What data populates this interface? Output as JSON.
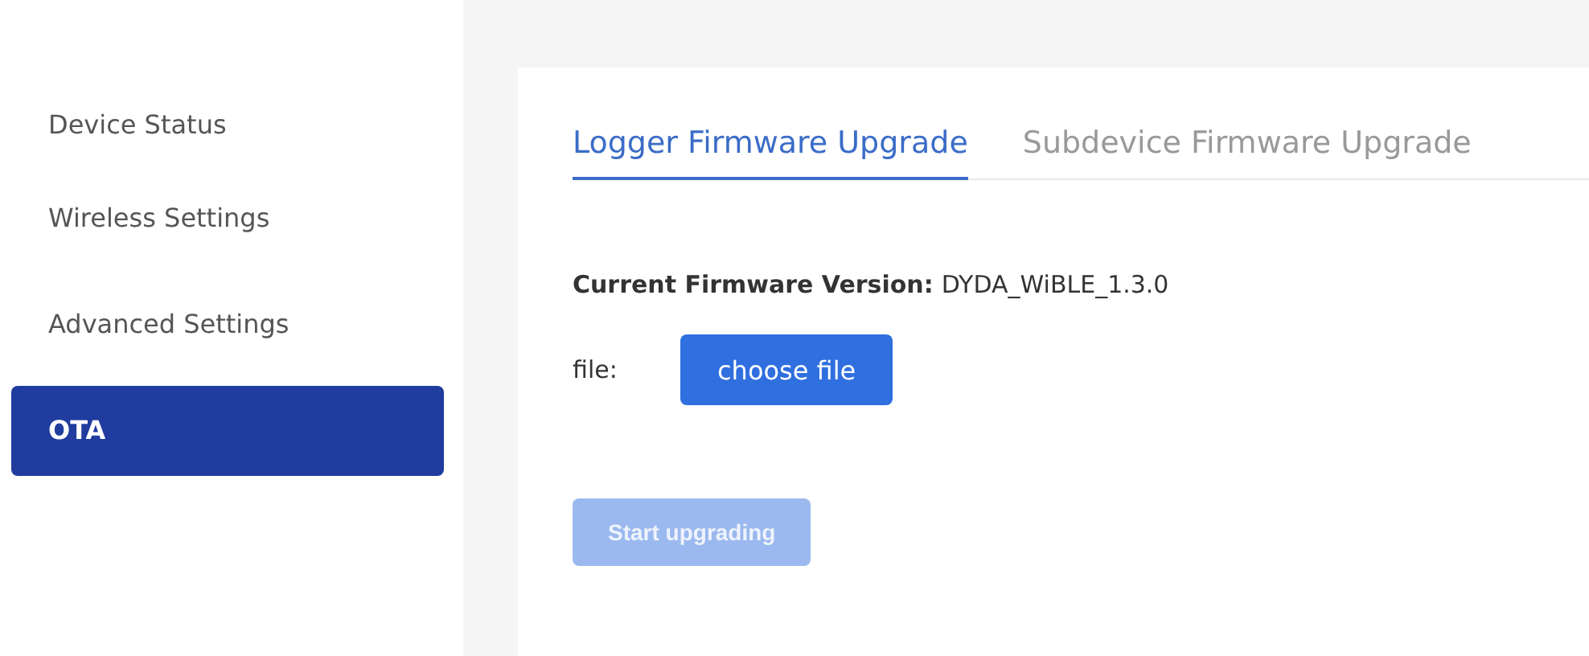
{
  "sidebar": {
    "items": [
      {
        "label": "Device Status",
        "selected": false
      },
      {
        "label": "Wireless Settings",
        "selected": false
      },
      {
        "label": "Advanced Settings",
        "selected": false
      },
      {
        "label": "OTA",
        "selected": true
      }
    ]
  },
  "tabs": [
    {
      "label": "Logger Firmware Upgrade",
      "selected": true
    },
    {
      "label": "Subdevice Firmware Upgrade",
      "selected": false
    }
  ],
  "version": {
    "label": "Current Firmware Version:",
    "value": "DYDA_WiBLE_1.3.0"
  },
  "file": {
    "label": "file:",
    "button": "choose file"
  },
  "start_button": {
    "label": "Start upgrading",
    "disabled": true
  }
}
